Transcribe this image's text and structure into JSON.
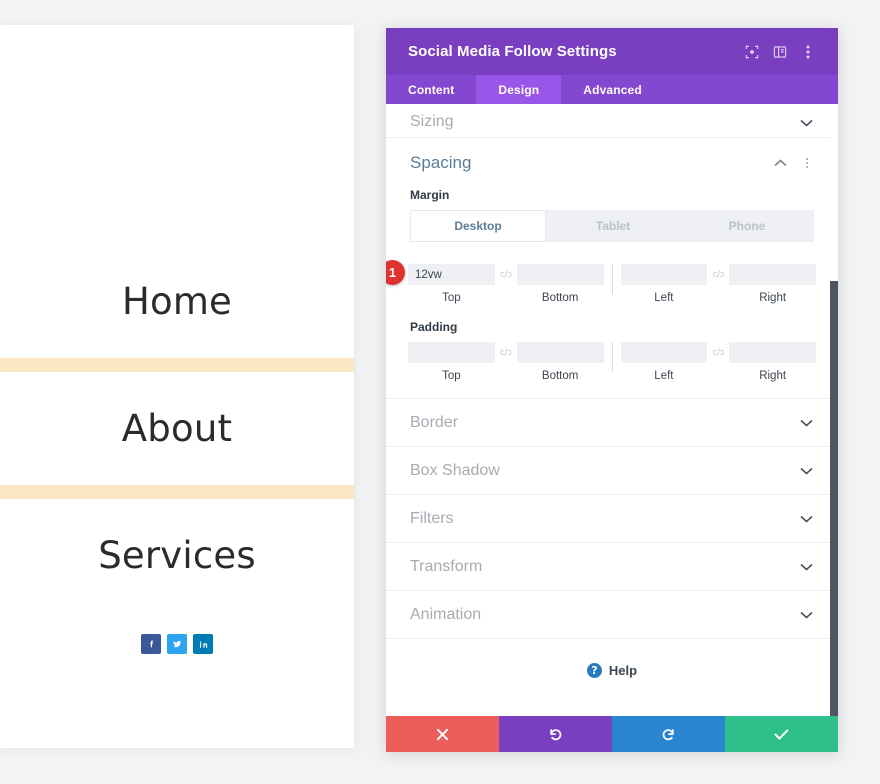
{
  "preview": {
    "menu_items": [
      {
        "label": "Home"
      },
      {
        "label": "About"
      },
      {
        "label": "Services"
      }
    ],
    "separator_color": "#fbe7c2",
    "social": [
      {
        "name": "facebook",
        "glyph": "f",
        "color": "#3b5998"
      },
      {
        "name": "twitter",
        "glyph": "t",
        "color": "#2ea3f2"
      },
      {
        "name": "linkedin",
        "glyph": "in",
        "color": "#007bb6"
      }
    ]
  },
  "panel": {
    "title": "Social Media Follow Settings",
    "header_icons": [
      {
        "name": "focus-icon"
      },
      {
        "name": "layout-panel-icon"
      },
      {
        "name": "more-vertical-icon"
      }
    ],
    "tabs": [
      {
        "label": "Content",
        "active": false
      },
      {
        "label": "Design",
        "active": true
      },
      {
        "label": "Advanced",
        "active": false
      }
    ],
    "accent_color": "#7a3ec0",
    "tab_bar_color": "#8447cf",
    "active_tab_color": "#9a56e8",
    "sections_above": [
      {
        "label": "Sizing",
        "expanded": false,
        "chevron": "down"
      }
    ],
    "spacing": {
      "title": "Spacing",
      "expanded": true,
      "chevron": "up",
      "margin": {
        "label": "Margin",
        "devices": [
          {
            "label": "Desktop",
            "active": true
          },
          {
            "label": "Tablet",
            "active": false
          },
          {
            "label": "Phone",
            "active": false
          }
        ],
        "fields": [
          {
            "sublabel": "Top",
            "value": "12vw"
          },
          {
            "sublabel": "Bottom",
            "value": ""
          },
          {
            "sublabel": "Left",
            "value": ""
          },
          {
            "sublabel": "Right",
            "value": ""
          }
        ],
        "badge": "1",
        "badge_color": "#e03131"
      },
      "padding": {
        "label": "Padding",
        "fields": [
          {
            "sublabel": "Top",
            "value": ""
          },
          {
            "sublabel": "Bottom",
            "value": ""
          },
          {
            "sublabel": "Left",
            "value": ""
          },
          {
            "sublabel": "Right",
            "value": ""
          }
        ]
      },
      "link_icon_label": "c/ɔ"
    },
    "sections_below": [
      {
        "label": "Border",
        "expanded": false,
        "chevron": "down"
      },
      {
        "label": "Box Shadow",
        "expanded": false,
        "chevron": "down"
      },
      {
        "label": "Filters",
        "expanded": false,
        "chevron": "down"
      },
      {
        "label": "Transform",
        "expanded": false,
        "chevron": "down"
      },
      {
        "label": "Animation",
        "expanded": false,
        "chevron": "down"
      }
    ],
    "help": {
      "label": "Help",
      "icon_glyph": "?"
    },
    "footer_buttons": [
      {
        "name": "cancel-button",
        "icon": "close-icon",
        "color": "#ec5e5a"
      },
      {
        "name": "undo-button",
        "icon": "undo-icon",
        "color": "#7a3ec0"
      },
      {
        "name": "redo-button",
        "icon": "redo-icon",
        "color": "#2a85d0"
      },
      {
        "name": "save-button",
        "icon": "check-icon",
        "color": "#2ec08b"
      }
    ]
  }
}
